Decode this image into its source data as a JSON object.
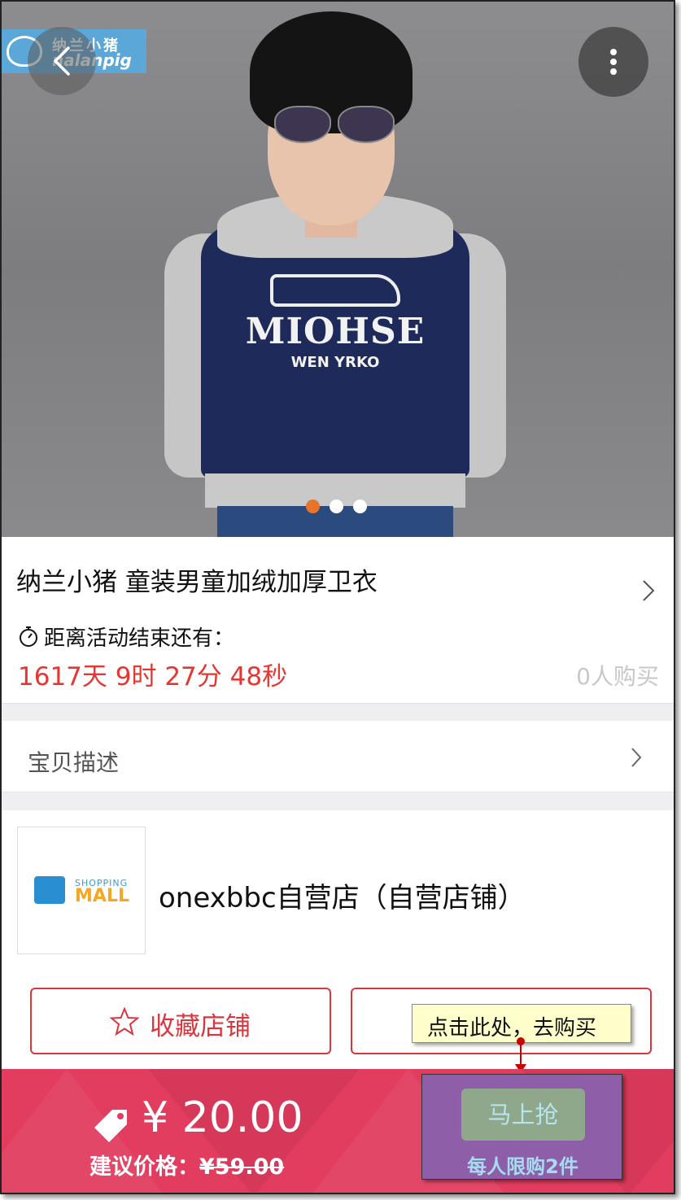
{
  "hero": {
    "brand_logo_cn": "纳兰小猪",
    "brand_logo_en": "nalanpig",
    "shirt_print_big": "MIOHSE",
    "shirt_print_small": "WEN YRKO",
    "carousel_pages": 3,
    "carousel_active": 1,
    "back_icon": "chevron-left-icon",
    "more_icon": "vertical-dots-icon"
  },
  "product": {
    "title": "纳兰小猪 童装男童加绒加厚卫衣",
    "countdown_label": "距离活动结束还有：",
    "countdown": "1617天 9时 27分 48秒",
    "buyers": "0人购买"
  },
  "description": {
    "label": "宝贝描述"
  },
  "store": {
    "logo_top": "SHOPPING",
    "logo_main": "MALL",
    "name": "onexbbc自营店（自营店铺）",
    "favorite_label": "收藏店铺"
  },
  "tooltip": {
    "text": "点击此处，去购买"
  },
  "bottom_bar": {
    "price": "¥ 20.00",
    "suggest_label": "建议价格：",
    "suggest_price": "¥59.00",
    "buy_label": "马上抢",
    "limit_text": "每人限购2件"
  },
  "colors": {
    "accent_red": "#e53631",
    "bottom_bar": "#e23c5e",
    "buy_panel": "#8e5fa8",
    "carousel_active_dot": "#e8742a"
  }
}
